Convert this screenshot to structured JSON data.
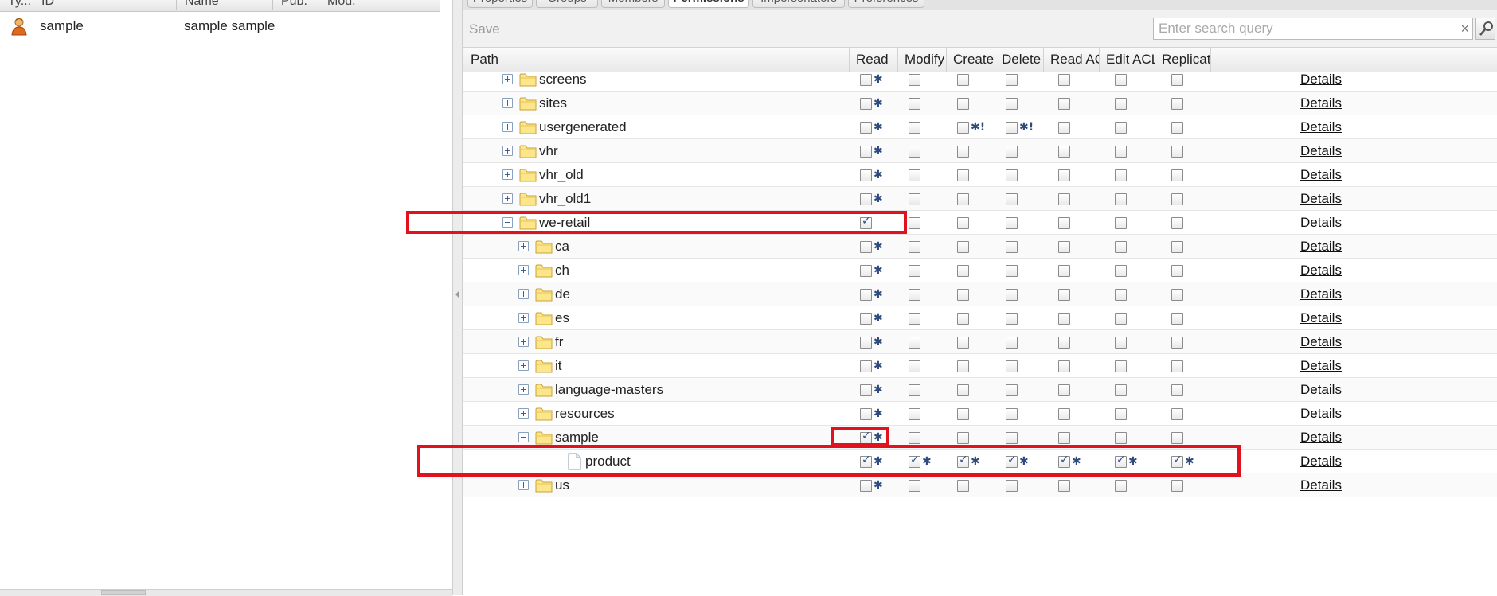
{
  "left": {
    "columns": [
      "Ty...",
      "ID",
      "Name",
      "Pub.",
      "Mod."
    ],
    "user": {
      "id": "sample",
      "name": "sample sample"
    }
  },
  "tabs": [
    "Properties",
    "Groups",
    "Members",
    "Permissions",
    "Impersonators",
    "Preferences"
  ],
  "toolbar": {
    "save_label": "Save",
    "search_placeholder": "Enter search query",
    "clear_glyph": "×"
  },
  "grid": {
    "columns": [
      "Path",
      "Read",
      "Modify",
      "Create",
      "Delete",
      "Read ACL",
      "Edit ACL",
      "Replicate"
    ],
    "details_label": "Details",
    "rows": [
      {
        "name": "screens",
        "depth": 0,
        "icon": "folder-icon",
        "expander": "plus",
        "read": false,
        "read_mark": "✱",
        "modify": false,
        "create": false,
        "create_mark": "",
        "delete": false,
        "delete_mark": "",
        "read_acl": false,
        "edit_acl": false,
        "replicate": false
      },
      {
        "name": "sites",
        "depth": 0,
        "icon": "folder-icon",
        "expander": "plus",
        "read": false,
        "read_mark": "✱",
        "modify": false,
        "create": false,
        "create_mark": "",
        "delete": false,
        "delete_mark": "",
        "read_acl": false,
        "edit_acl": false,
        "replicate": false
      },
      {
        "name": "usergenerated",
        "depth": 0,
        "icon": "folder-icon",
        "expander": "plus",
        "read": false,
        "read_mark": "✱",
        "modify": false,
        "create": false,
        "create_mark": "✱!",
        "delete": false,
        "delete_mark": "✱!",
        "read_acl": false,
        "edit_acl": false,
        "replicate": false
      },
      {
        "name": "vhr",
        "depth": 0,
        "icon": "folder-icon",
        "expander": "plus",
        "read": false,
        "read_mark": "✱",
        "modify": false,
        "create": false,
        "create_mark": "",
        "delete": false,
        "delete_mark": "",
        "read_acl": false,
        "edit_acl": false,
        "replicate": false
      },
      {
        "name": "vhr_old",
        "depth": 0,
        "icon": "folder-icon",
        "expander": "plus",
        "read": false,
        "read_mark": "✱",
        "modify": false,
        "create": false,
        "create_mark": "",
        "delete": false,
        "delete_mark": "",
        "read_acl": false,
        "edit_acl": false,
        "replicate": false
      },
      {
        "name": "vhr_old1",
        "depth": 0,
        "icon": "folder-icon",
        "expander": "plus",
        "read": false,
        "read_mark": "✱",
        "modify": false,
        "create": false,
        "create_mark": "",
        "delete": false,
        "delete_mark": "",
        "read_acl": false,
        "edit_acl": false,
        "replicate": false
      },
      {
        "name": "we-retail",
        "depth": 0,
        "icon": "folder-icon",
        "expander": "minus",
        "read": true,
        "read_mark": "",
        "modify": false,
        "create": false,
        "create_mark": "",
        "delete": false,
        "delete_mark": "",
        "read_acl": false,
        "edit_acl": false,
        "replicate": false
      },
      {
        "name": "ca",
        "depth": 1,
        "icon": "folder-icon",
        "expander": "plus",
        "read": false,
        "read_mark": "✱",
        "modify": false,
        "create": false,
        "create_mark": "",
        "delete": false,
        "delete_mark": "",
        "read_acl": false,
        "edit_acl": false,
        "replicate": false
      },
      {
        "name": "ch",
        "depth": 1,
        "icon": "folder-icon",
        "expander": "plus",
        "read": false,
        "read_mark": "✱",
        "modify": false,
        "create": false,
        "create_mark": "",
        "delete": false,
        "delete_mark": "",
        "read_acl": false,
        "edit_acl": false,
        "replicate": false
      },
      {
        "name": "de",
        "depth": 1,
        "icon": "folder-icon",
        "expander": "plus",
        "read": false,
        "read_mark": "✱",
        "modify": false,
        "create": false,
        "create_mark": "",
        "delete": false,
        "delete_mark": "",
        "read_acl": false,
        "edit_acl": false,
        "replicate": false
      },
      {
        "name": "es",
        "depth": 1,
        "icon": "folder-icon",
        "expander": "plus",
        "read": false,
        "read_mark": "✱",
        "modify": false,
        "create": false,
        "create_mark": "",
        "delete": false,
        "delete_mark": "",
        "read_acl": false,
        "edit_acl": false,
        "replicate": false
      },
      {
        "name": "fr",
        "depth": 1,
        "icon": "folder-icon",
        "expander": "plus",
        "read": false,
        "read_mark": "✱",
        "modify": false,
        "create": false,
        "create_mark": "",
        "delete": false,
        "delete_mark": "",
        "read_acl": false,
        "edit_acl": false,
        "replicate": false
      },
      {
        "name": "it",
        "depth": 1,
        "icon": "folder-icon",
        "expander": "plus",
        "read": false,
        "read_mark": "✱",
        "modify": false,
        "create": false,
        "create_mark": "",
        "delete": false,
        "delete_mark": "",
        "read_acl": false,
        "edit_acl": false,
        "replicate": false
      },
      {
        "name": "language-masters",
        "depth": 1,
        "icon": "folder-icon",
        "expander": "plus",
        "read": false,
        "read_mark": "✱",
        "modify": false,
        "create": false,
        "create_mark": "",
        "delete": false,
        "delete_mark": "",
        "read_acl": false,
        "edit_acl": false,
        "replicate": false
      },
      {
        "name": "resources",
        "depth": 1,
        "icon": "folder-icon",
        "expander": "plus",
        "read": false,
        "read_mark": "✱",
        "modify": false,
        "create": false,
        "create_mark": "",
        "delete": false,
        "delete_mark": "",
        "read_acl": false,
        "edit_acl": false,
        "replicate": false
      },
      {
        "name": "sample",
        "depth": 1,
        "icon": "folder-icon",
        "expander": "minus",
        "read": true,
        "read_mark": "✱",
        "modify": false,
        "create": false,
        "create_mark": "",
        "delete": false,
        "delete_mark": "",
        "read_acl": false,
        "edit_acl": false,
        "replicate": false
      },
      {
        "name": "product",
        "depth": 2,
        "icon": "page-icon",
        "expander": "none",
        "read": true,
        "read_mark": "✱",
        "modify": true,
        "modify_mark": "✱",
        "create": true,
        "create_mark": "✱",
        "delete": true,
        "delete_mark": "✱",
        "read_acl": true,
        "read_acl_mark": "✱",
        "edit_acl": true,
        "edit_acl_mark": "✱",
        "replicate": true,
        "replicate_mark": "✱"
      },
      {
        "name": "us",
        "depth": 1,
        "icon": "folder-icon",
        "expander": "plus",
        "read": false,
        "read_mark": "✱",
        "modify": false,
        "create": false,
        "create_mark": "",
        "delete": false,
        "delete_mark": "",
        "read_acl": false,
        "edit_acl": false,
        "replicate": false
      }
    ]
  },
  "colors": {
    "highlight": "#e1121e",
    "check": "#2a4f8a",
    "inherit_mark": "#2d4a7d"
  }
}
